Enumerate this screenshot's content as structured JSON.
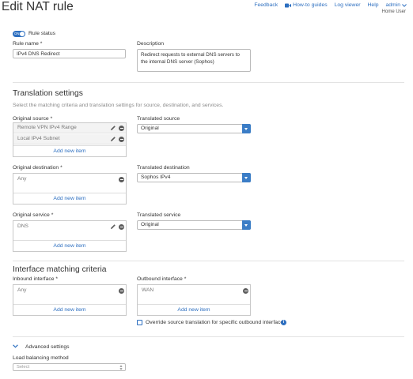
{
  "header": {
    "title": "Edit NAT rule",
    "nav": {
      "feedback": "Feedback",
      "howto": "How-to guides",
      "log_viewer": "Log viewer",
      "help": "Help",
      "admin": "admin"
    },
    "user_role": "Home User"
  },
  "rule_status": {
    "toggle_text": "ON",
    "label": "Rule status"
  },
  "rule_name": {
    "label": "Rule name *",
    "value": "IPv4 DNS Redirect"
  },
  "description": {
    "label": "Description",
    "value": "Redirect requests to external DNS servers to the internal DNS server (Sophos)"
  },
  "translation": {
    "title": "Translation settings",
    "desc": "Select the matching criteria and translation settings for source, destination, and services.",
    "original_source": {
      "label": "Original source *",
      "items": [
        "Remote VPN IPv4 Range",
        "Local IPv4 Subnet"
      ],
      "add_label": "Add new item"
    },
    "translated_source": {
      "label": "Translated source",
      "value": "Original"
    },
    "original_destination": {
      "label": "Original destination *",
      "items": [
        "Any"
      ],
      "add_label": "Add new item"
    },
    "translated_destination": {
      "label": "Translated destination",
      "value": "Sophos IPv4"
    },
    "original_service": {
      "label": "Original service *",
      "items": [
        "DNS"
      ],
      "add_label": "Add new item"
    },
    "translated_service": {
      "label": "Translated service",
      "value": "Original"
    }
  },
  "interface": {
    "title": "Interface matching criteria",
    "inbound": {
      "label": "Inbound interface *",
      "items": [
        "Any"
      ],
      "add_label": "Add new item"
    },
    "outbound": {
      "label": "Outbound interface *",
      "items": [
        "WAN"
      ],
      "add_label": "Add new item"
    },
    "override_label": "Override source translation for specific outbound interfaces",
    "info_glyph": "i"
  },
  "advanced": {
    "label": "Advanced settings",
    "load_balancing": {
      "label": "Load balancing method",
      "placeholder": "Select"
    }
  },
  "colors": {
    "accent": "#2d6fc0",
    "select_caret": "#3b7dc6"
  }
}
